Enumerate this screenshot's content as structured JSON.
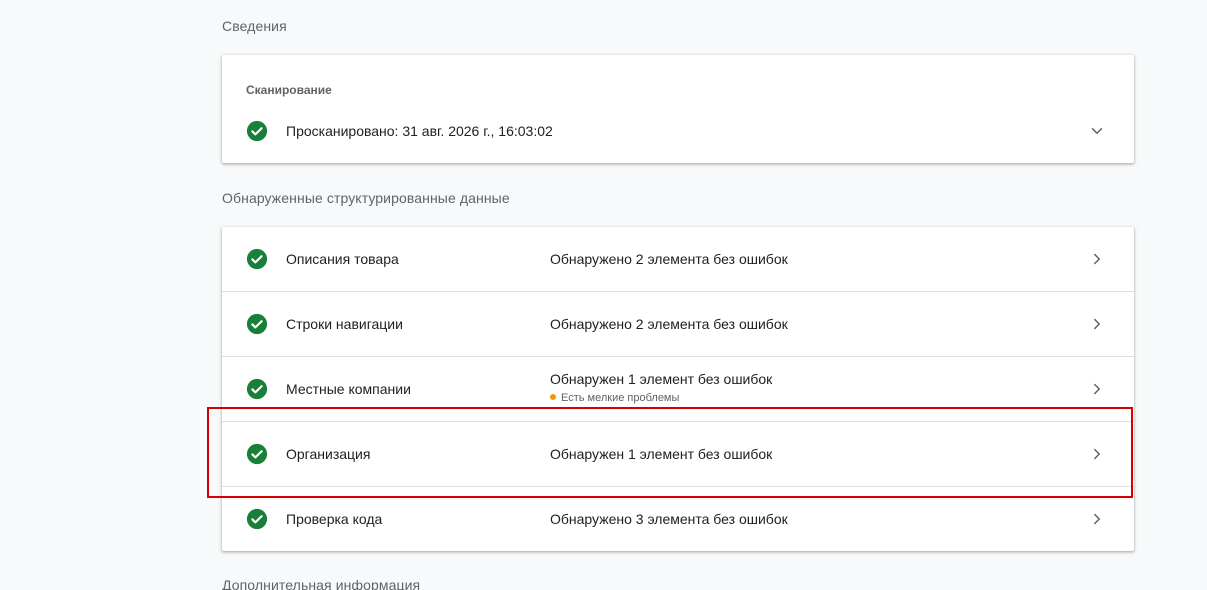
{
  "sections": {
    "details_heading": "Сведения",
    "structured_heading": "Обнаруженные структурированные данные",
    "additional_heading": "Дополнительная информация"
  },
  "crawl": {
    "label": "Сканирование",
    "status": "Просканировано: 31 авг. 2026 г., 16:03:02"
  },
  "structured_items": [
    {
      "name": "Описания товара",
      "status": "Обнаружено 2 элемента без ошибок",
      "sub": ""
    },
    {
      "name": "Строки навигации",
      "status": "Обнаружено 2 элемента без ошибок",
      "sub": ""
    },
    {
      "name": "Местные компании",
      "status": "Обнаружен 1 элемент без ошибок",
      "sub": "Есть мелкие проблемы"
    },
    {
      "name": "Организация",
      "status": "Обнаружен 1 элемент без ошибок",
      "sub": ""
    },
    {
      "name": "Проверка кода",
      "status": "Обнаружено 3 элемента без ошибок",
      "sub": ""
    }
  ],
  "icons": {
    "check": "check-circle-icon",
    "expand": "chevron-down-icon",
    "row_arrow": "chevron-right-icon",
    "warning_dot": "warning-dot-icon"
  },
  "colors": {
    "success": "#188038",
    "warning": "#f29900",
    "highlight": "#d50000"
  }
}
